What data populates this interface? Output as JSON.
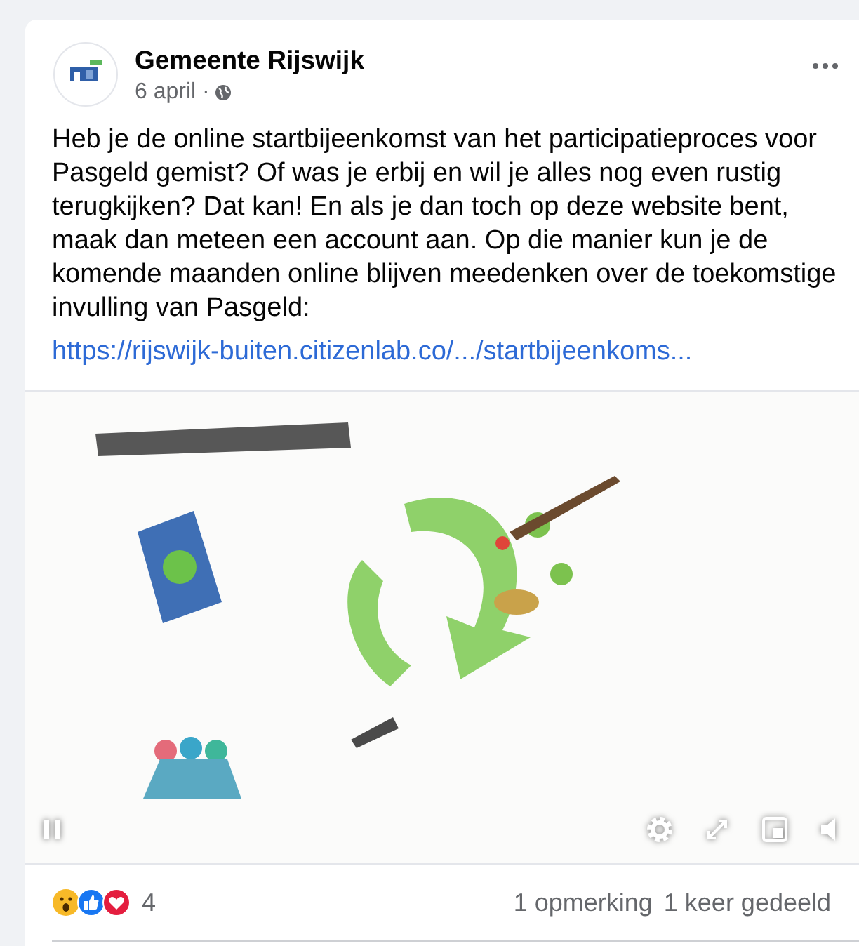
{
  "post": {
    "author": "Gemeente Rijswijk",
    "date": "6 april ·",
    "text": "Heb je de online startbijeenkomst van het participatieproces voor Pasgeld gemist? Of was je erbij en wil je alles nog even rustig terugkijken? Dat kan! En als je dan toch op deze website bent, maak dan meteen een account aan. Op die manier kun je de komende maanden online blijven meedenken over de toekomstige invulling van Pasgeld:",
    "link": "https://rijswijk-buiten.citizenlab.co/.../startbijeenkoms..."
  },
  "video": {
    "playing": true
  },
  "footer": {
    "reactions_count": "4",
    "comments": "1 opmerking",
    "shares": "1 keer gedeeld"
  }
}
